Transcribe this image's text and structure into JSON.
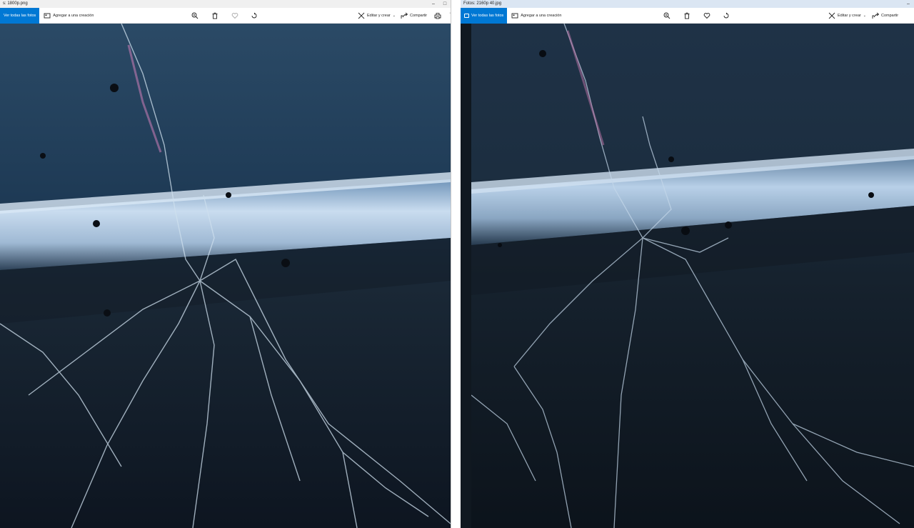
{
  "left_window": {
    "title": "s: 1800p.png",
    "toolbar": {
      "all_photos": "Ver todas las fotos",
      "add_to_creation": "Agregar a una creación",
      "edit_create": "Editar y crear",
      "share": "Compartir",
      "more": "···"
    }
  },
  "right_window": {
    "title": "Fotos: 2160p 40.jpg",
    "toolbar": {
      "all_photos": "Ver todas las fotos",
      "add_to_creation": "Agregar a una creación",
      "edit_create": "Editar y crear",
      "share": "Compartir"
    }
  },
  "window_controls": {
    "minimize": "–",
    "maximize": "□",
    "close": "✕"
  },
  "colors": {
    "accent": "#0078d4",
    "photo_top": "#2b4a66",
    "photo_bottom": "#0d1520",
    "bar": "#b8d0e8"
  }
}
